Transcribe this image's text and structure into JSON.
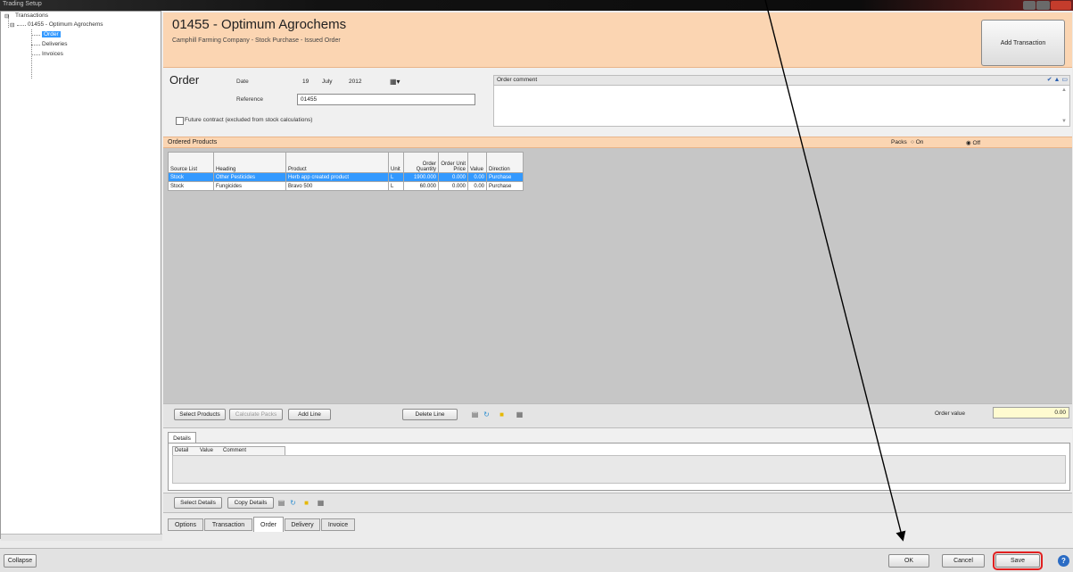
{
  "window": {
    "title": "Trading Setup"
  },
  "tree": {
    "root": "Transactions",
    "transaction": "01455 - Optimum Agrochems",
    "children": [
      "Order",
      "Deliveries",
      "Invoices"
    ]
  },
  "header": {
    "title": "01455 - Optimum Agrochems",
    "subtitle": "Camphill Farming Company - Stock Purchase - Issued Order",
    "add_transaction": "Add Transaction"
  },
  "order": {
    "title": "Order",
    "date_label": "Date",
    "date_day": "19",
    "date_month": "July",
    "date_year": "2012",
    "reference_label": "Reference",
    "reference_value": "01455",
    "future_contract": "Future contract (excluded from stock calculations)",
    "comment_label": "Order comment"
  },
  "ordered_products": {
    "title": "Ordered Products",
    "packs_label": "Packs",
    "on": "On",
    "off": "Off",
    "columns": [
      "Source List",
      "Heading",
      "Product",
      "Unit",
      "Order Quantity",
      "Order Unit Price",
      "Value",
      "Direction"
    ],
    "rows": [
      [
        "Stock",
        "Other Pesticides",
        "Herb app created product",
        "L",
        "1900.000",
        "0.000",
        "0.00",
        "Purchase"
      ],
      [
        "Stock",
        "Fungicides",
        "Bravo 500",
        "L",
        "60.000",
        "0.000",
        "0.00",
        "Purchase"
      ]
    ]
  },
  "products_toolbar": {
    "select_products": "Select Products",
    "calculate_packs": "Calculate Packs",
    "add_line": "Add Line",
    "delete_line": "Delete Line",
    "order_value_label": "Order value",
    "order_value": "0.00"
  },
  "details": {
    "tab": "Details",
    "columns": [
      "Detail",
      "Value",
      "Comment"
    ],
    "select_details": "Select Details",
    "copy_details": "Copy Details"
  },
  "tabs": [
    "Options",
    "Transaction",
    "Order",
    "Delivery",
    "Invoice"
  ],
  "status": {
    "collapse": "Collapse",
    "ok": "OK",
    "cancel": "Cancel",
    "save": "Save"
  }
}
